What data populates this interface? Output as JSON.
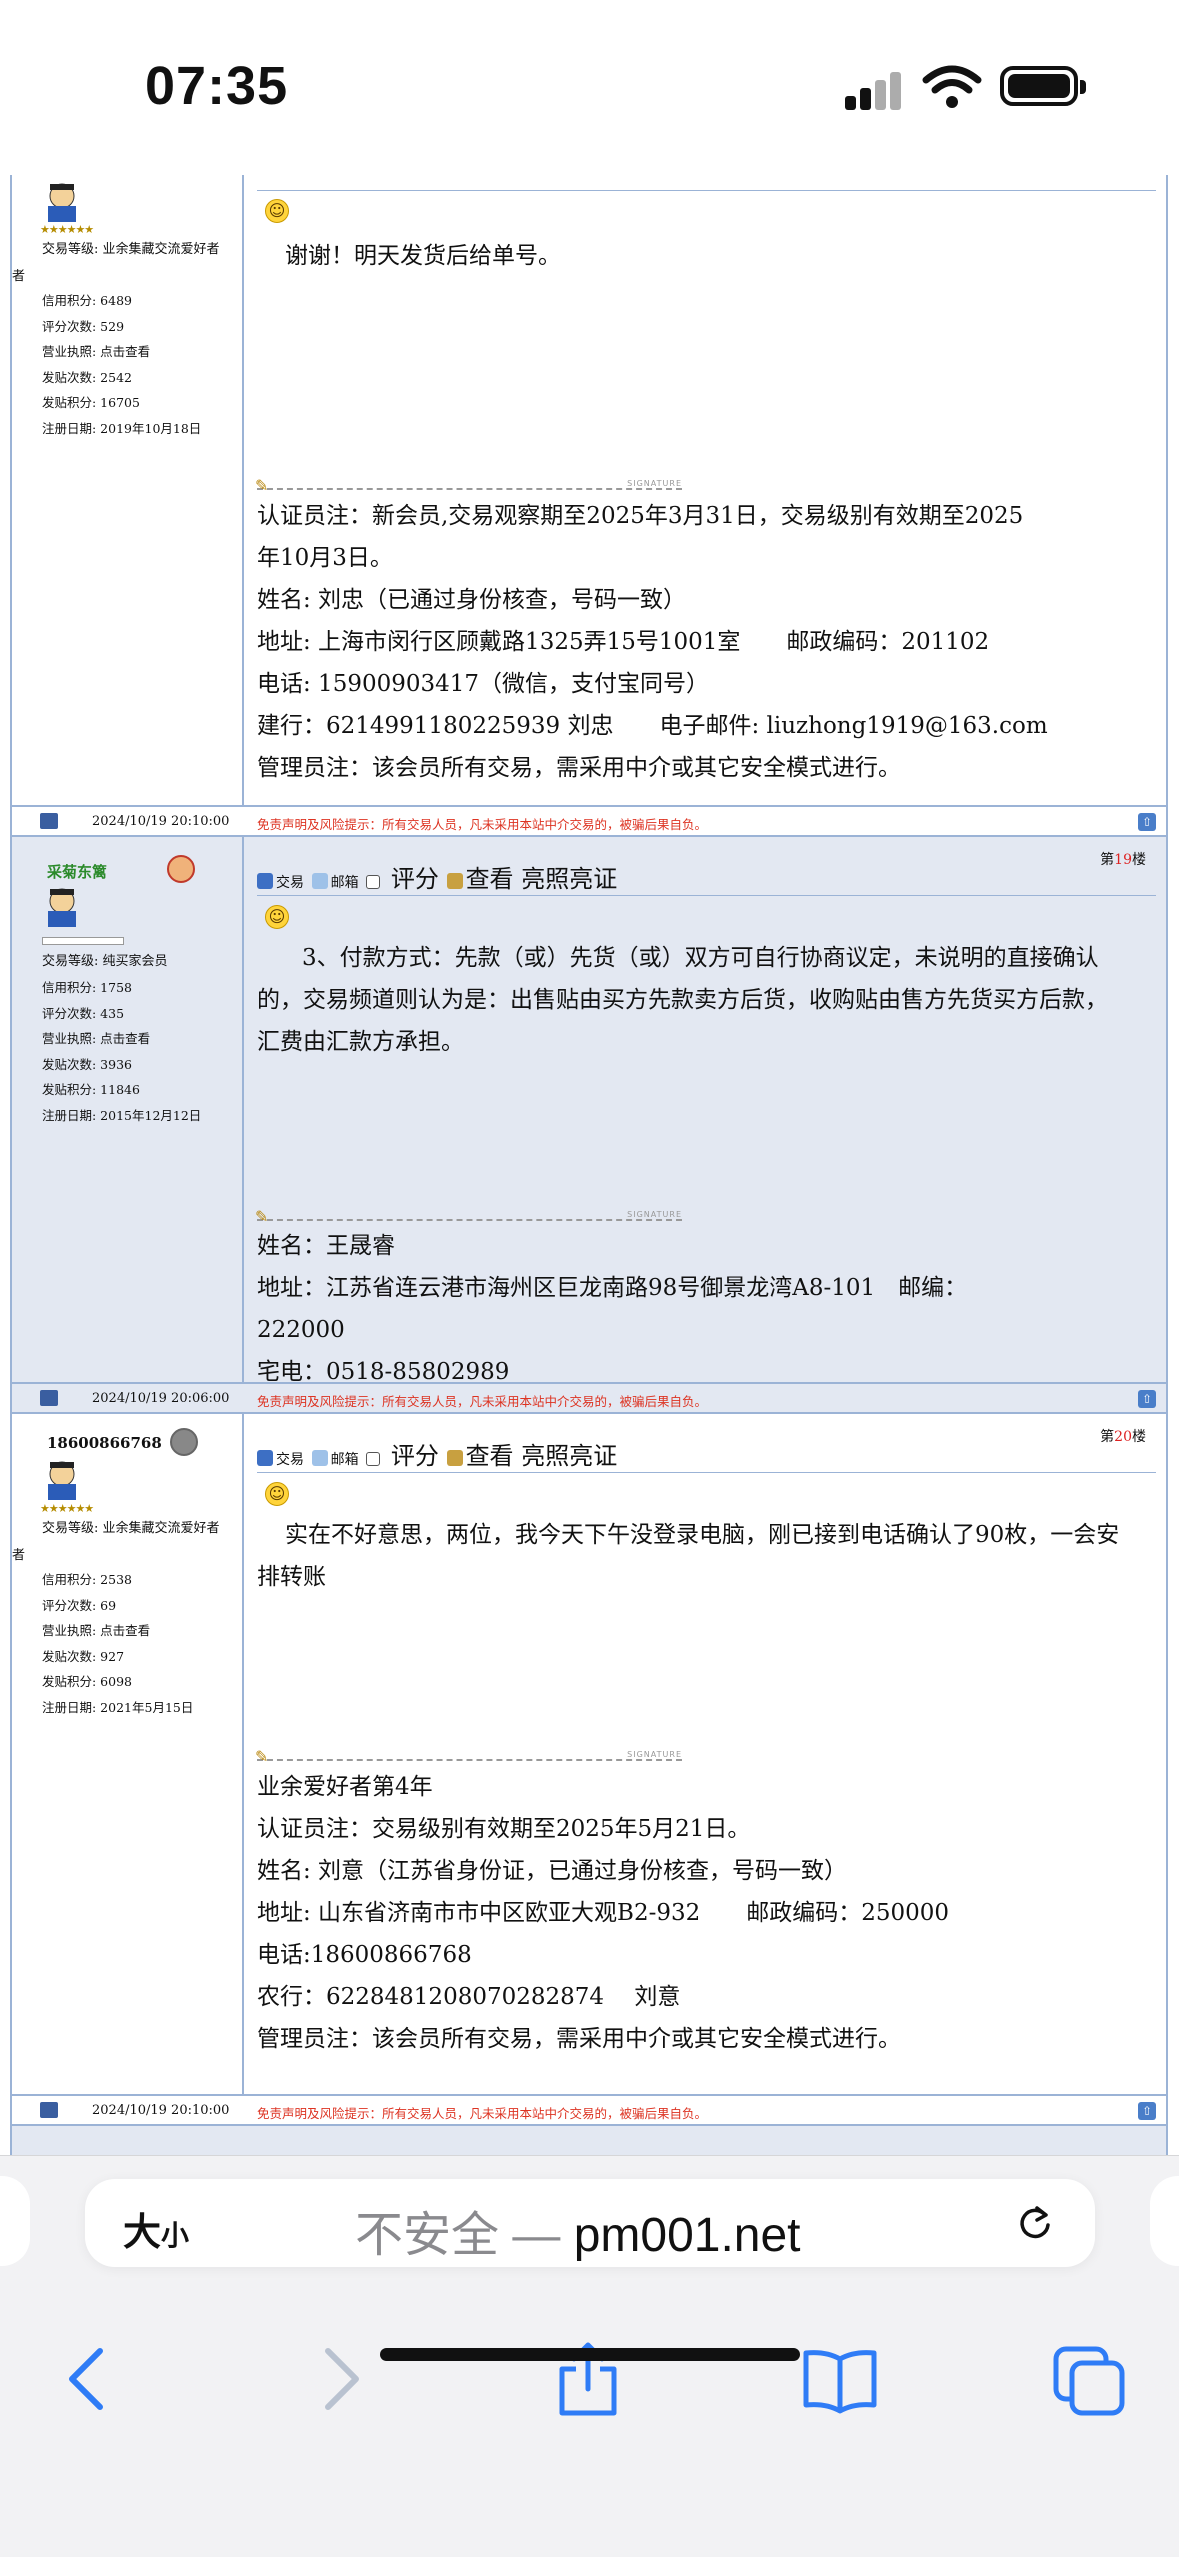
{
  "status_bar": {
    "time": "07:35"
  },
  "posts": [
    {
      "user": {
        "name": "",
        "level": "交易等级: 业余集藏交流爱好者"
      },
      "stats": [
        "信用积分: 6489",
        "评分次数: 529",
        "营业执照: 点击查看",
        "发贴次数: 2542",
        "发贴积分: 16705",
        "注册日期: 2019年10月18日"
      ],
      "body": [
        "谢谢！明天发货后给单号。"
      ],
      "signature": [
        "认证员注：新会员,交易观察期至2025年3月31日，交易级别有效期至2025",
        "年10月3日。",
        "姓名: 刘忠（已通过身份核查，号码一致）",
        "地址: 上海市闵行区顾戴路1325弄15号1001室　　邮政编码：201102",
        "电话: 15900903417（微信，支付宝同号）",
        "建行：6214991180225939  刘忠　　电子邮件: liuzhong1919@163.com",
        "管理员注：该会员所有交易，需采用中介或其它安全模式进行。"
      ],
      "footer_time": "2024/10/19 20:10:00"
    },
    {
      "user": {
        "name": "采菊东篱",
        "level": "交易等级: 纯买家会员"
      },
      "stats": [
        "信用积分: 1758",
        "评分次数: 435",
        "营业执照: 点击查看",
        "发贴次数: 3936",
        "发贴积分: 11846",
        "注册日期: 2015年12月12日"
      ],
      "floor_prefix": "第",
      "floor_num": "19",
      "floor_suffix": "楼",
      "body": [
        "3、付款方式：先款（或）先货（或）双方可自行协商议定，未说明的直接确认",
        "的，交易频道则认为是：出售贴由买方先款卖方后货，收购贴由售方先货买方后款，",
        "汇费由汇款方承担。"
      ],
      "signature": [
        "姓名：王晟睿",
        "地址：江苏省连云港市海州区巨龙南路98号御景龙湾A8-101　邮编：",
        "222000",
        "宅电：0518-85802989"
      ],
      "footer_time": "2024/10/19 20:06:00"
    },
    {
      "user": {
        "name": "18600866768",
        "level": "交易等级: 业余集藏交流爱好者"
      },
      "stats": [
        "信用积分: 2538",
        "评分次数: 69",
        "营业执照: 点击查看",
        "发贴次数: 927",
        "发贴积分: 6098",
        "注册日期: 2021年5月15日"
      ],
      "floor_prefix": "第",
      "floor_num": "20",
      "floor_suffix": "楼",
      "body": [
        "实在不好意思，两位，我今天下午没登录电脑，刚已接到电话确认了90枚，一会安",
        "排转账"
      ],
      "signature": [
        "业余爱好者第4年",
        "认证员注：交易级别有效期至2025年5月21日。",
        "姓名: 刘意（江苏省身份证，已通过身份核查，号码一致）",
        "地址: 山东省济南市市中区欧亚大观B2-932　　邮政编码：250000",
        "电话:18600866768",
        "农行：6228481208070282874　 刘意",
        "管理员注：该会员所有交易，需采用中介或其它安全模式进行。"
      ],
      "footer_time": "2024/10/19 20:10:00"
    }
  ],
  "toolbar": {
    "trade": "交易",
    "mail": "邮箱",
    "rate": "评分",
    "view": "查看 亮照亮证"
  },
  "zhe": "者",
  "disclaimer": "免责声明及风险提示：所有交易人员，凡未采用本站中介交易的，被骗后果自负。",
  "safari": {
    "text_size": "大",
    "text_size_small": "小",
    "insecure": "不安全 — ",
    "domain": "pm001.net"
  }
}
